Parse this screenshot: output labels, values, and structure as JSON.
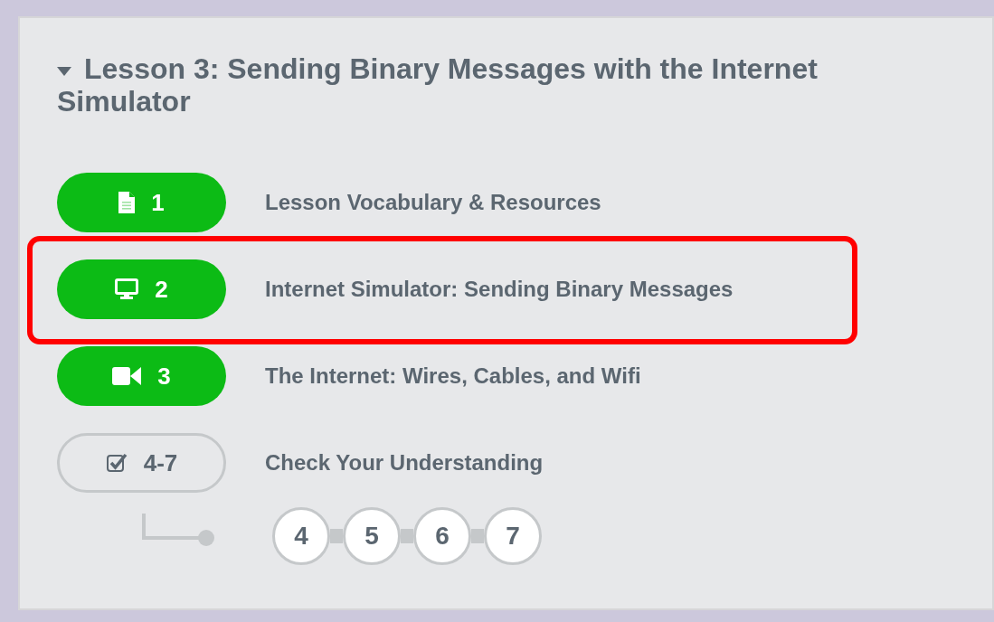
{
  "lesson": {
    "title": "Lesson 3: Sending Binary Messages with the Internet Simulator",
    "expanded": true,
    "levels": [
      {
        "kind": "document",
        "number": "1",
        "label": "Lesson Vocabulary & Resources",
        "completed": true,
        "highlighted": false
      },
      {
        "kind": "online",
        "number": "2",
        "label": "Internet Simulator: Sending Binary Messages",
        "completed": true,
        "highlighted": true
      },
      {
        "kind": "video",
        "number": "3",
        "label": "The Internet: Wires, Cables, and Wifi",
        "completed": true,
        "highlighted": false
      },
      {
        "kind": "assessment",
        "number": "4-7",
        "label": "Check Your Understanding",
        "completed": false,
        "highlighted": false,
        "sublevels": [
          "4",
          "5",
          "6",
          "7"
        ]
      }
    ]
  }
}
